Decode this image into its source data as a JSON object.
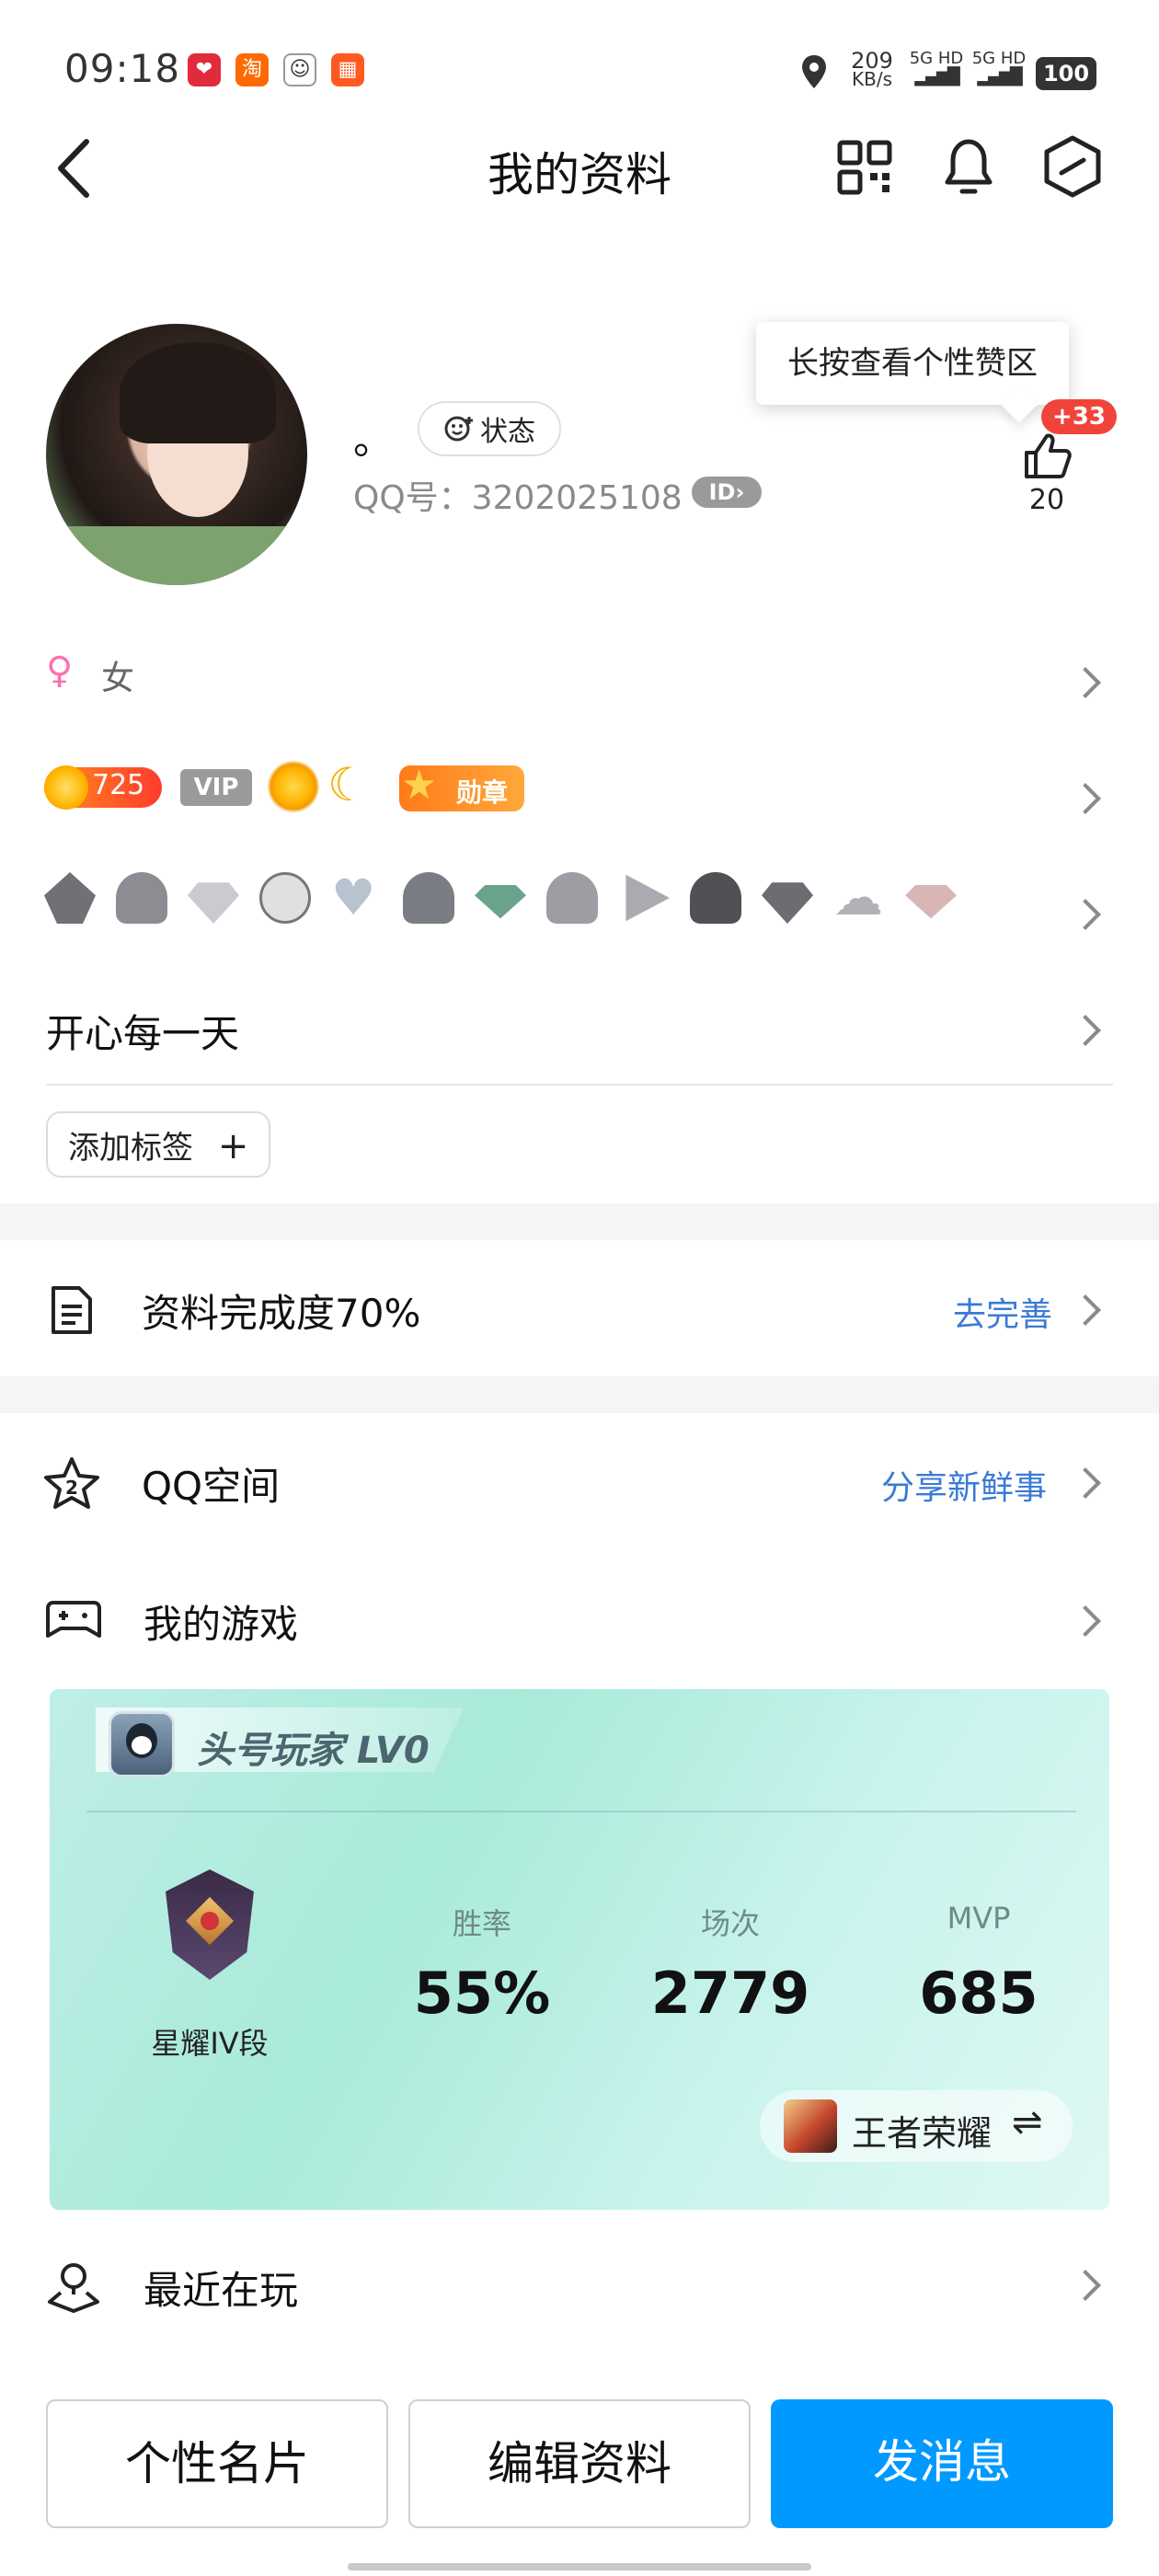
{
  "status_bar": {
    "time": "09:18",
    "net_speed": "209",
    "net_unit": "KB/s",
    "sim1": "5G HD",
    "sim2": "5G HD",
    "battery": "100"
  },
  "header": {
    "title": "我的资料"
  },
  "profile": {
    "nickname": "。",
    "status_label": "状态",
    "qq_number": "QQ号：3202025108",
    "id_badge": "ID",
    "tooltip": "长按查看个性赞区",
    "like_badge": "+33",
    "like_count": "20"
  },
  "info": {
    "gender": "女",
    "level_value": "725",
    "vip_label": "VIP",
    "medal_label": "勋章",
    "signature": "开心每一天",
    "add_tag": "添加标签"
  },
  "completion": {
    "label": "资料完成度70%",
    "action": "去完善"
  },
  "qzone": {
    "label": "QQ空间",
    "action": "分享新鲜事",
    "icon_number": "2"
  },
  "games": {
    "label": "我的游戏",
    "card": {
      "title": "头号玩家 LV0",
      "rank": "星耀IV段",
      "stats": [
        {
          "label": "胜率",
          "value": "55%"
        },
        {
          "label": "场次",
          "value": "2779"
        },
        {
          "label": "MVP",
          "value": "685"
        }
      ],
      "game_name": "王者荣耀",
      "switch_icon": "⇌"
    }
  },
  "recent": {
    "label": "最近在玩"
  },
  "bottom_buttons": {
    "card": "个性名片",
    "edit": "编辑资料",
    "message": "发消息"
  },
  "colors": {
    "accent": "#0099ff",
    "link": "#3a7bd5",
    "badge": "#f0443a"
  }
}
